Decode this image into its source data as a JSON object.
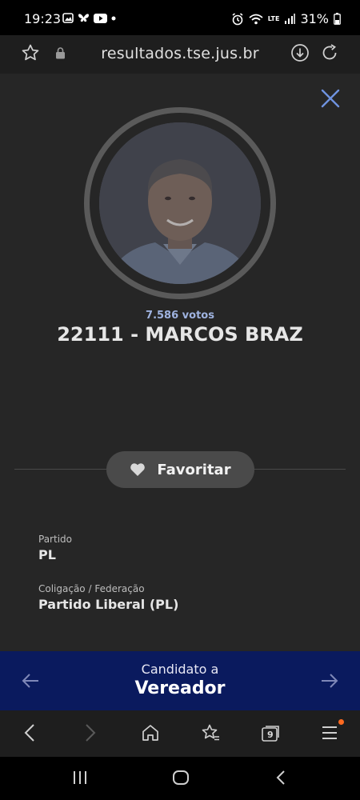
{
  "status_bar": {
    "time": "19:23",
    "battery": "31%",
    "network_label": "LTE"
  },
  "browser": {
    "url": "resultados.tse.jus.br"
  },
  "candidate": {
    "votes": "7.586 votos",
    "name": "22111 - MARCOS BRAZ"
  },
  "favorite_button": {
    "label": "Favoritar"
  },
  "details": {
    "party_label": "Partido",
    "party_value": "PL",
    "coalition_label": "Coligação / Federação",
    "coalition_value": "Partido Liberal (PL)"
  },
  "role_bar": {
    "subtitle": "Candidato a",
    "title": "Vereador"
  },
  "toolbar": {
    "tab_count": "9"
  },
  "colors": {
    "background": "#262626",
    "role_bar": "#0a1a5e",
    "votes_text": "#9fb3e0",
    "close_icon": "#6f93e0",
    "notification_dot": "#ff6a20"
  }
}
